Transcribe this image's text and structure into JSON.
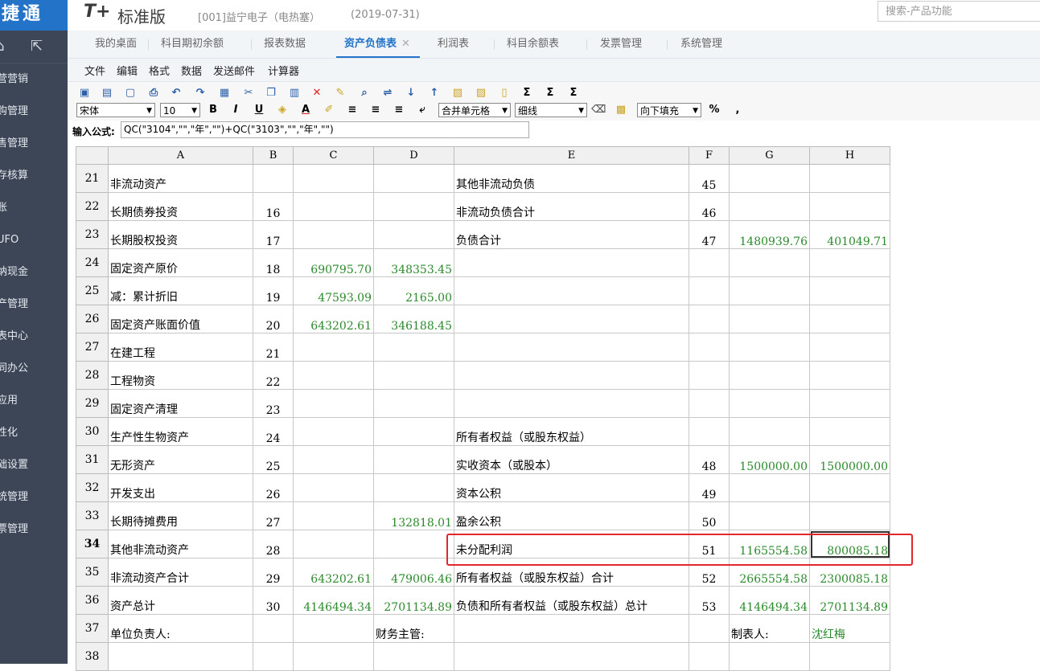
{
  "app": {
    "logo": "捷通",
    "brand_mark": "T+",
    "edition": "标准版",
    "company": "[001]益宁电子（电热塞）",
    "date": "(2019-07-31)",
    "search_placeholder": "搜索-产品功能"
  },
  "sidebar": {
    "items": [
      "营销",
      "采购管理",
      "销售管理",
      "库存核算",
      "总账",
      "UFO",
      "出纳现金",
      "资产管理",
      "报表中心",
      "协同办公",
      "应用",
      "个性化",
      "基础设置",
      "系统管理",
      "发票管理"
    ],
    "visible_labels": [
      "营营销",
      "购管理",
      "售管理",
      "存核算",
      "账",
      "UFO",
      "纳现金",
      "产管理",
      "表中心",
      "同办公",
      "应用",
      "性化",
      "础设置",
      "统管理",
      "票管理"
    ]
  },
  "tabs": [
    {
      "label": "我的桌面"
    },
    {
      "label": "科目期初余额"
    },
    {
      "label": "报表数据"
    },
    {
      "label": "资产负债表",
      "active": true,
      "close": "✕"
    },
    {
      "label": "利润表"
    },
    {
      "label": "科目余额表"
    },
    {
      "label": "发票管理"
    },
    {
      "label": "系统管理"
    }
  ],
  "menu": [
    "文件",
    "编辑",
    "格式",
    "数据",
    "发送邮件",
    "计算器"
  ],
  "toolbar": {
    "font_name": "宋体",
    "font_size": "10",
    "merge": "合并单元格",
    "border": "细线",
    "fill": "向下填充",
    "bold": "B",
    "italic": "I",
    "underline": "U",
    "color_a": "A",
    "percent": "%",
    "comma": ","
  },
  "formula": {
    "label": "输入公式:",
    "value": "QC(\"3104\",\"\",\"年\",\"\")+QC(\"3103\",\"\",\"年\",\"\")"
  },
  "sheet": {
    "columns": [
      "A",
      "B",
      "C",
      "D",
      "E",
      "F",
      "G",
      "H"
    ],
    "rows": [
      {
        "num": "21",
        "a": "非流动资产",
        "b": "",
        "c": "",
        "d": "",
        "e": "其他非流动负债",
        "f": "45",
        "g": "",
        "h": ""
      },
      {
        "num": "22",
        "a": "长期债券投资",
        "b": "16",
        "c": "",
        "d": "",
        "e": "非流动负债合计",
        "f": "46",
        "g": "",
        "h": ""
      },
      {
        "num": "23",
        "a": "长期股权投资",
        "b": "17",
        "c": "",
        "d": "",
        "e": "负债合计",
        "f": "47",
        "g": "1480939.76",
        "h": "401049.71"
      },
      {
        "num": "24",
        "a": "固定资产原价",
        "b": "18",
        "c": "690795.70",
        "d": "348353.45",
        "e": "",
        "f": "",
        "g": "",
        "h": ""
      },
      {
        "num": "25",
        "a": "减：累计折旧",
        "b": "19",
        "c": "47593.09",
        "d": "2165.00",
        "e": "",
        "f": "",
        "g": "",
        "h": ""
      },
      {
        "num": "26",
        "a": "固定资产账面价值",
        "b": "20",
        "c": "643202.61",
        "d": "346188.45",
        "e": "",
        "f": "",
        "g": "",
        "h": ""
      },
      {
        "num": "27",
        "a": "在建工程",
        "b": "21",
        "c": "",
        "d": "",
        "e": "",
        "f": "",
        "g": "",
        "h": ""
      },
      {
        "num": "28",
        "a": "工程物资",
        "b": "22",
        "c": "",
        "d": "",
        "e": "",
        "f": "",
        "g": "",
        "h": ""
      },
      {
        "num": "29",
        "a": "固定资产清理",
        "b": "23",
        "c": "",
        "d": "",
        "e": "",
        "f": "",
        "g": "",
        "h": ""
      },
      {
        "num": "30",
        "a": "生产性生物资产",
        "b": "24",
        "c": "",
        "d": "",
        "e": "所有者权益（或股东权益）",
        "f": "",
        "g": "",
        "h": ""
      },
      {
        "num": "31",
        "a": "无形资产",
        "b": "25",
        "c": "",
        "d": "",
        "e": "实收资本（或股本）",
        "f": "48",
        "g": "1500000.00",
        "h": "1500000.00"
      },
      {
        "num": "32",
        "a": "开发支出",
        "b": "26",
        "c": "",
        "d": "",
        "e": "资本公积",
        "f": "49",
        "g": "",
        "h": ""
      },
      {
        "num": "33",
        "a": "长期待摊费用",
        "b": "27",
        "c": "",
        "d": "132818.01",
        "e": "盈余公积",
        "f": "50",
        "g": "",
        "h": ""
      },
      {
        "num": "34",
        "a": "其他非流动资产",
        "b": "28",
        "c": "",
        "d": "",
        "e": "未分配利润",
        "f": "51",
        "g": "1165554.58",
        "h": "800085.18"
      },
      {
        "num": "35",
        "a": "非流动资产合计",
        "b": "29",
        "c": "643202.61",
        "d": "479006.46",
        "e": "所有者权益（或股东权益）合计",
        "f": "52",
        "g": "2665554.58",
        "h": "2300085.18"
      },
      {
        "num": "36",
        "a": "资产总计",
        "b": "30",
        "c": "4146494.34",
        "d": "2701134.89",
        "e": "负债和所有者权益（或股东权益）总计",
        "f": "53",
        "g": "4146494.34",
        "h": "2701134.89"
      },
      {
        "num": "37",
        "a": "单位负责人:",
        "b": "",
        "c": "",
        "d": "财务主管:",
        "e": "",
        "f": "",
        "g": "制表人:",
        "h": "沈红梅"
      },
      {
        "num": "38",
        "a": "",
        "b": "",
        "c": "",
        "d": "",
        "e": "",
        "f": "",
        "g": "",
        "h": ""
      }
    ],
    "current_row": "34"
  }
}
